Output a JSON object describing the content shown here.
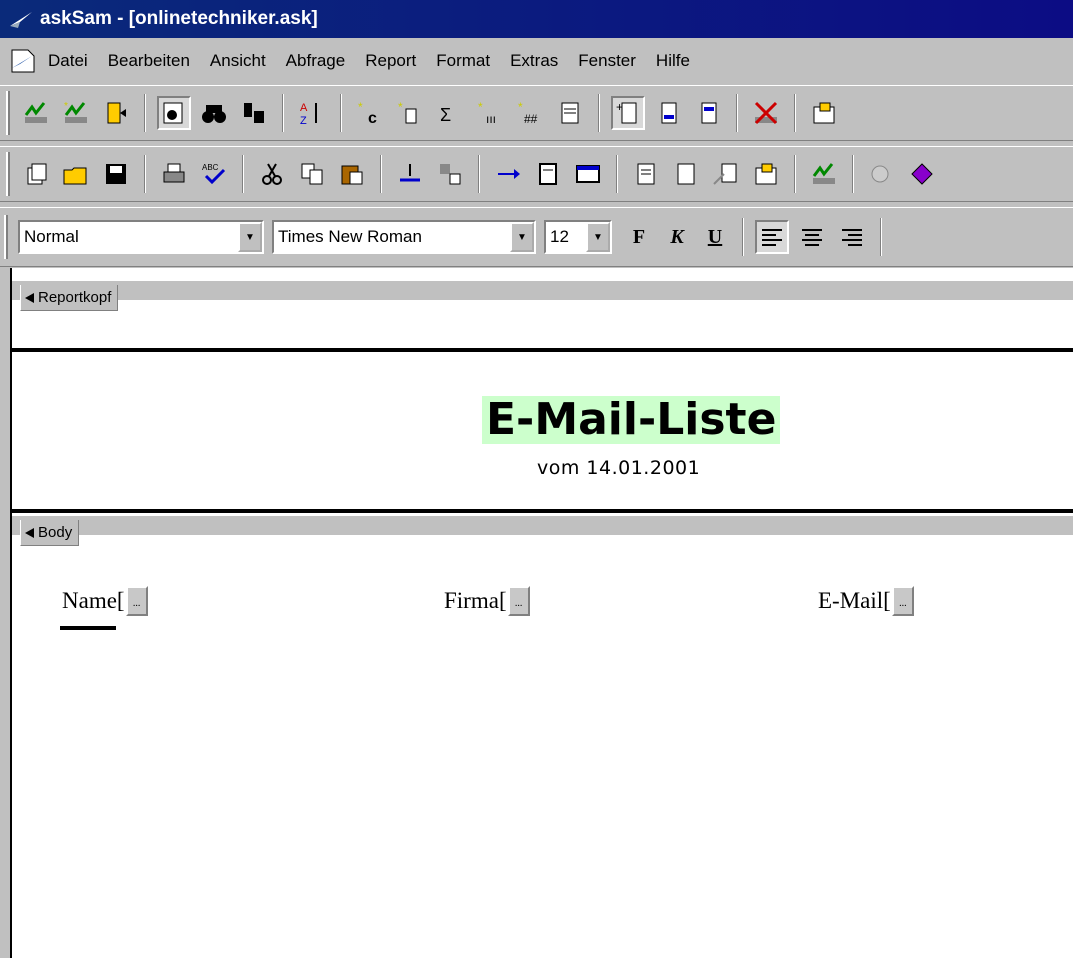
{
  "window": {
    "title": "askSam - [onlinetechniker.ask]"
  },
  "menu": [
    {
      "key": "datei",
      "label": "Datei"
    },
    {
      "key": "bearbeiten",
      "label": "Bearbeiten"
    },
    {
      "key": "ansicht",
      "label": "Ansicht"
    },
    {
      "key": "abfrage",
      "label": "Abfrage"
    },
    {
      "key": "report",
      "label": "Report"
    },
    {
      "key": "format",
      "label": "Format"
    },
    {
      "key": "extras",
      "label": "Extras"
    },
    {
      "key": "fenster",
      "label": "Fenster"
    },
    {
      "key": "hilfe",
      "label": "Hilfe"
    }
  ],
  "format_toolbar": {
    "style": "Normal",
    "font": "Times New Roman",
    "size": "12",
    "bold": "F",
    "italic": "K",
    "underline": "U"
  },
  "report": {
    "header_section": "Reportkopf",
    "body_section": "Body",
    "title": "E-Mail-Liste",
    "date": "vom 14.01.2001",
    "fields": [
      {
        "label": "Name["
      },
      {
        "label": "Firma["
      },
      {
        "label": "E-Mail["
      }
    ]
  },
  "colors": {
    "titlebar": "#0c0c84",
    "title_highlight": "#ccffcc"
  }
}
